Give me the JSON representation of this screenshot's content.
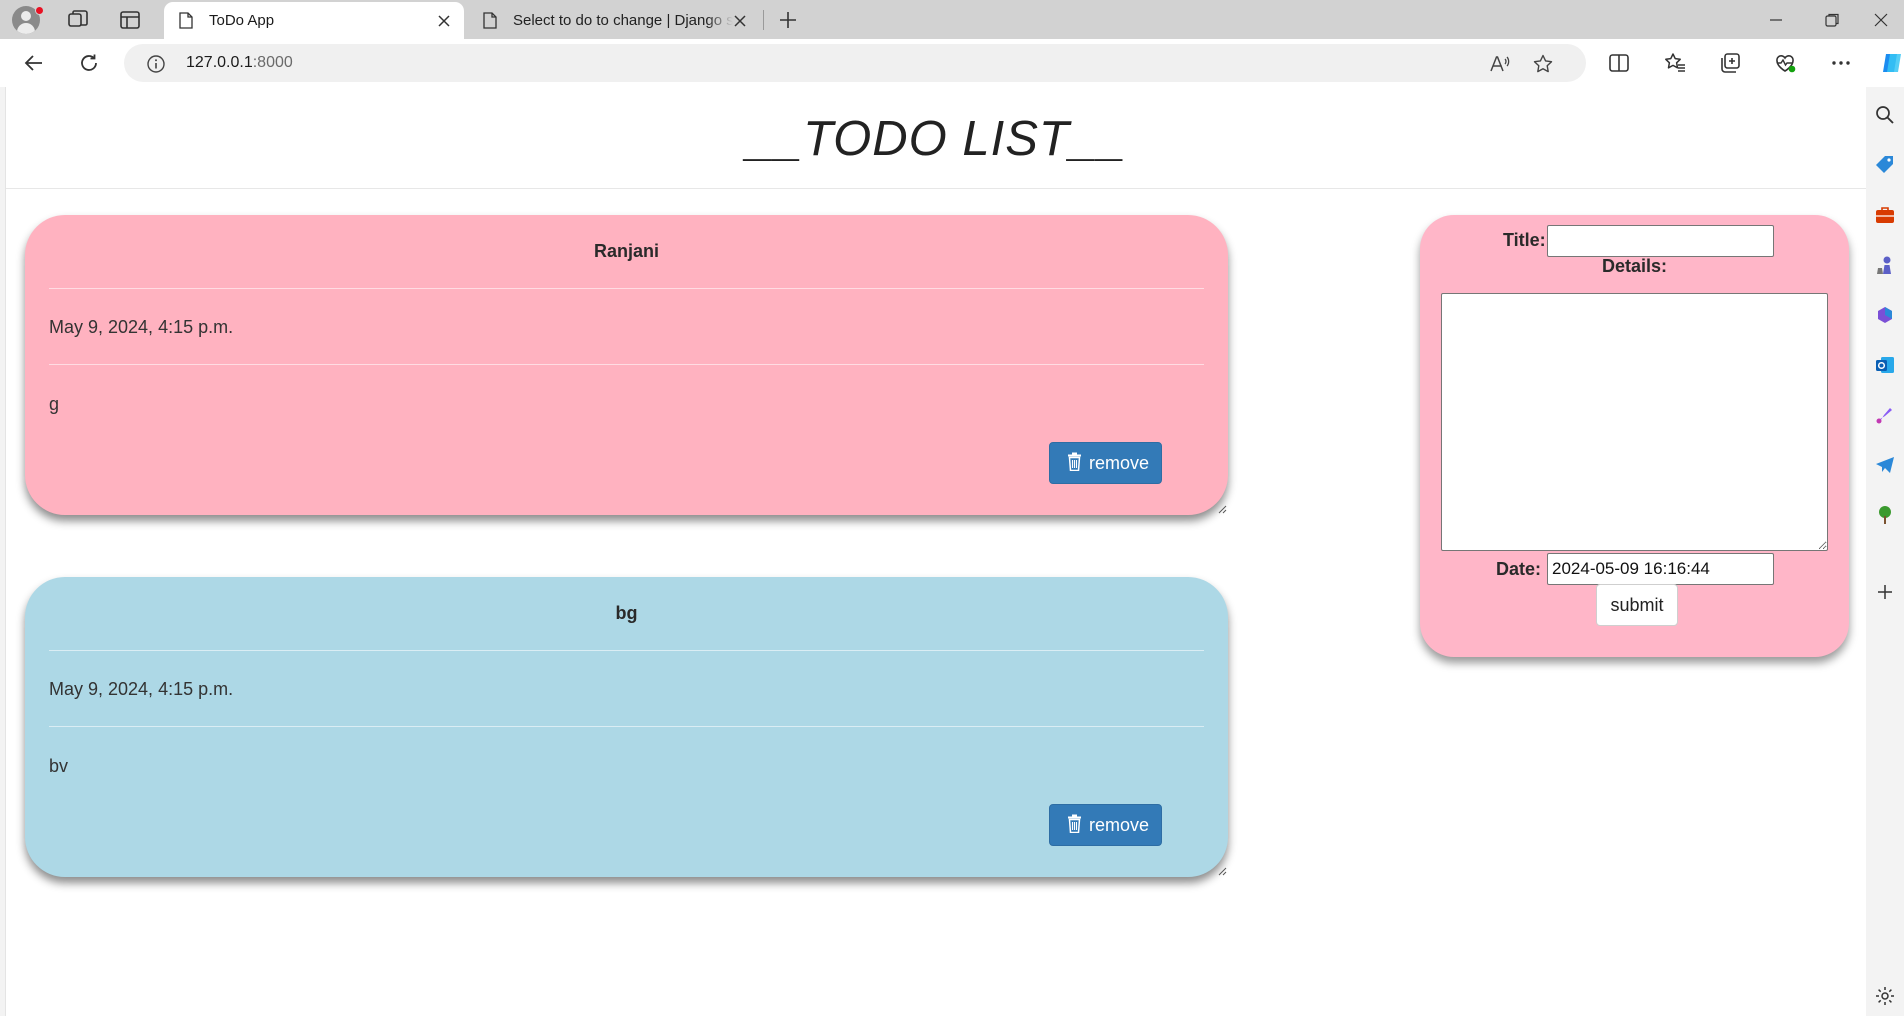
{
  "browser": {
    "tabs": [
      {
        "title": "ToDo App",
        "active": true
      },
      {
        "title": "Select to do to change | Django site admin",
        "active": false
      }
    ],
    "url_host": "127.0.0.1",
    "url_port": ":8000"
  },
  "page": {
    "title": "__TODO LIST__"
  },
  "todos": [
    {
      "title": "Ranjani",
      "date": "May 9, 2024, 4:15 p.m.",
      "details": "g",
      "remove_label": "remove",
      "color": "#ffb2c0"
    },
    {
      "title": "bg",
      "date": "May 9, 2024, 4:15 p.m.",
      "details": "bv",
      "remove_label": "remove",
      "color": "#add8e6"
    }
  ],
  "form": {
    "title_label": "Title:",
    "title_value": "",
    "details_label": "Details:",
    "details_value": "",
    "date_label": "Date:",
    "date_value": "2024-05-09 16:16:44",
    "submit_label": "submit",
    "color": "#ffb6c8"
  },
  "colors": {
    "remove_button": "#337ab7",
    "tab_strip": "#d2d2d2"
  }
}
